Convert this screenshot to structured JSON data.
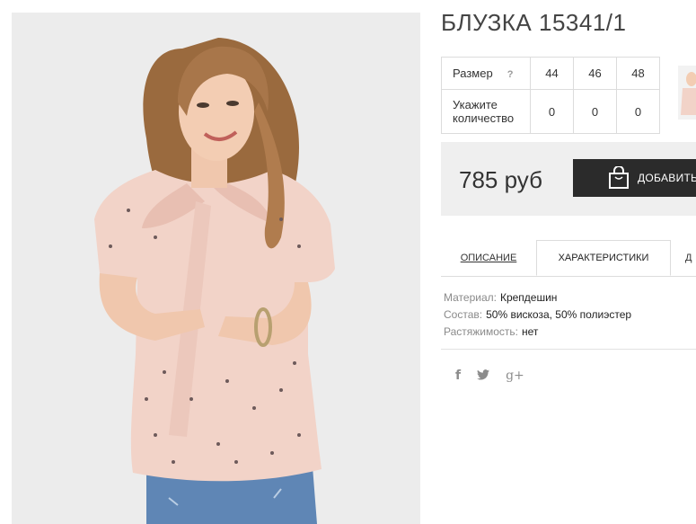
{
  "product": {
    "title": "БЛУЗКА 15341/1",
    "price": "785 руб",
    "add_button_label": "ДОБАВИТЬ"
  },
  "sizes": {
    "size_label": "Размер",
    "help_mark": "?",
    "quantity_label": "Укажите количество",
    "columns": [
      {
        "size": "44",
        "quantity": "0"
      },
      {
        "size": "46",
        "quantity": "0"
      },
      {
        "size": "48",
        "quantity": "0"
      }
    ]
  },
  "tabs": [
    {
      "label": "ОПИСАНИЕ",
      "active": false
    },
    {
      "label": "ХАРАКТЕРИСТИКИ",
      "active": true
    },
    {
      "label": "Д",
      "active": false
    }
  ],
  "properties": [
    {
      "key": "Материал:",
      "value": "Крепдешин"
    },
    {
      "key": "Состав:",
      "value": "50% вискоза, 50% полиэстер"
    },
    {
      "key": "Растяжимость:",
      "value": "нет"
    }
  ],
  "social": {
    "facebook": "f",
    "twitter": "twitter-icon",
    "googleplus": "g+"
  },
  "colors": {
    "button_bg": "#2b2b2b",
    "buybox_bg": "#efefef",
    "blouse": "#f2d3c8"
  }
}
